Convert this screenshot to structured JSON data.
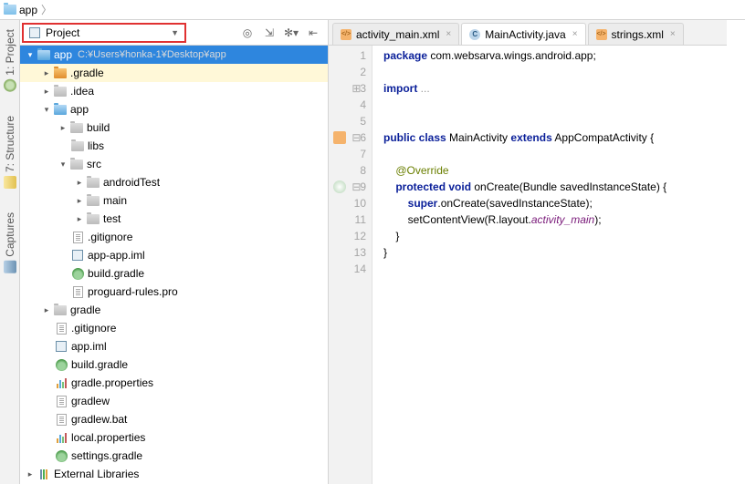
{
  "breadcrumb": {
    "item0": "app"
  },
  "project_dropdown": {
    "label": "Project"
  },
  "left_rail": {
    "project": "1: Project",
    "structure": "7: Structure",
    "captures": "Captures"
  },
  "tree": {
    "root": {
      "name": "app",
      "path": "C:¥Users¥honka-1¥Desktop¥app"
    },
    "n_gradle_dir": ".gradle",
    "n_idea": ".idea",
    "n_app": "app",
    "n_build": "build",
    "n_libs": "libs",
    "n_src": "src",
    "n_androidTest": "androidTest",
    "n_main": "main",
    "n_test": "test",
    "n_gitignore1": ".gitignore",
    "n_appapp_iml": "app-app.iml",
    "n_build_gradle1": "build.gradle",
    "n_proguard": "proguard-rules.pro",
    "n_gradle_dir2": "gradle",
    "n_gitignore2": ".gitignore",
    "n_app_iml": "app.iml",
    "n_build_gradle2": "build.gradle",
    "n_gradle_props": "gradle.properties",
    "n_gradlew": "gradlew",
    "n_gradlew_bat": "gradlew.bat",
    "n_local_props": "local.properties",
    "n_settings_gradle": "settings.gradle",
    "n_ext_libs": "External Libraries"
  },
  "tabs": {
    "t0": "activity_main.xml",
    "t1": "MainActivity.java",
    "t2": "strings.xml"
  },
  "gutter": [
    "1",
    "2",
    "3",
    "4",
    "5",
    "6",
    "7",
    "8",
    "9",
    "10",
    "11",
    "12",
    "13",
    "14"
  ],
  "code": {
    "l1_kw": "package",
    "l1_rest": " com.websarva.wings.android.app;",
    "l3_kw": "import",
    "l3_rest": " ...",
    "l6_a": "public class",
    "l6_b": " MainActivity ",
    "l6_c": "extends",
    "l6_d": " AppCompatActivity {",
    "l8": "@Override",
    "l9_a": "protected void",
    "l9_b": " onCreate(Bundle savedInstanceState) {",
    "l10_a": "super",
    "l10_b": ".onCreate(savedInstanceState);",
    "l11_a": "setContentView(R.layout.",
    "l11_b": "activity_main",
    "l11_c": ");",
    "l12": "}",
    "l13": "}"
  }
}
